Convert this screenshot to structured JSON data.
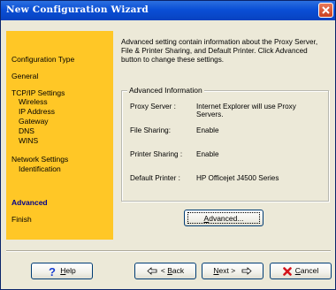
{
  "window": {
    "title": "New Configuration Wizard"
  },
  "sidebar": {
    "items": [
      {
        "label": "Configuration Type",
        "level": 0,
        "active": false
      },
      {
        "label": "General",
        "level": 0,
        "active": false
      },
      {
        "label": "TCP/IP Settings",
        "level": 0,
        "active": false
      },
      {
        "label": "Wireless",
        "level": 1,
        "active": false
      },
      {
        "label": "IP Address",
        "level": 1,
        "active": false
      },
      {
        "label": "Gateway",
        "level": 1,
        "active": false
      },
      {
        "label": "DNS",
        "level": 1,
        "active": false
      },
      {
        "label": "WINS",
        "level": 1,
        "active": false
      },
      {
        "label": "Network Settings",
        "level": 0,
        "active": false
      },
      {
        "label": "Identification",
        "level": 1,
        "active": false
      },
      {
        "label": "Advanced",
        "level": 0,
        "active": true
      },
      {
        "label": "Finish",
        "level": 0,
        "active": false
      }
    ]
  },
  "intro": {
    "line1": "Advanced setting contain information about the Proxy Server,",
    "line2": "File & Printer Sharing, and Default Printer. Click Advanced",
    "line3": "button to change these settings."
  },
  "advanced_info": {
    "legend": "Advanced Information",
    "rows": [
      {
        "label": "Proxy Server :",
        "value_line1": "Internet Explorer will use Proxy",
        "value_line2": "Servers."
      },
      {
        "label": "File Sharing:",
        "value_line1": "Enable",
        "value_line2": ""
      },
      {
        "label": "Printer Sharing :",
        "value_line1": "Enable",
        "value_line2": ""
      },
      {
        "label": "Default Printer :",
        "value_line1": "HP Officejet J4500 Series",
        "value_line2": ""
      }
    ]
  },
  "buttons": {
    "advanced": {
      "mnemonic": "A",
      "rest": "dvanced..."
    },
    "help": {
      "mnemonic": "H",
      "rest": "elp"
    },
    "back": {
      "prefix": "< ",
      "mnemonic": "B",
      "rest": "ack"
    },
    "next": {
      "mnemonic": "N",
      "rest": "ext >"
    },
    "cancel": {
      "mnemonic": "C",
      "rest": "ancel"
    }
  },
  "colors": {
    "sidebar_bg": "#ffc726",
    "title_bar": "#0a4fd6",
    "active_nav": "#00008b"
  },
  "icons": {
    "help": "question-mark-icon",
    "back": "arrow-left-icon",
    "next": "arrow-right-icon",
    "cancel": "red-x-icon",
    "close": "close-icon"
  }
}
